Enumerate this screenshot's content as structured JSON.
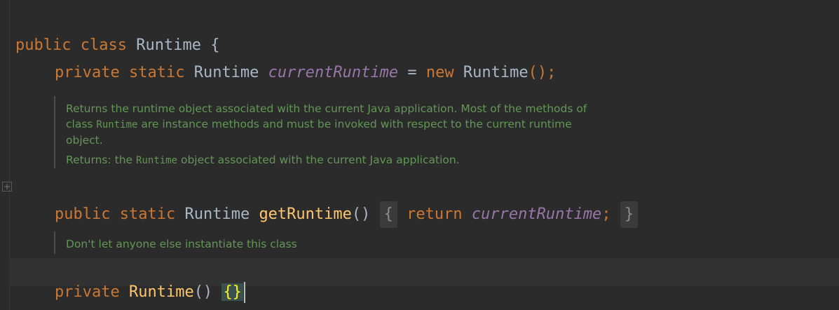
{
  "lines": {
    "class_decl": {
      "kw1": "public",
      "kw2": "class",
      "name": "Runtime",
      "brace": "{"
    },
    "field_decl": {
      "kw1": "private",
      "kw2": "static",
      "type": "Runtime",
      "field": "currentRuntime",
      "eq": "=",
      "kw3": "new",
      "ctor": "Runtime",
      "tail": "();"
    },
    "getruntime": {
      "kw1": "public",
      "kw2": "static",
      "type": "Runtime",
      "method": "getRuntime",
      "parens": "()",
      "open": "{",
      "ret": "return",
      "field": "currentRuntime",
      "semi": ";",
      "close": "}"
    },
    "ctor": {
      "kw1": "private",
      "name": "Runtime",
      "parens": "()",
      "braces": "{}"
    }
  },
  "docs": {
    "doc1": {
      "line1": "Returns the runtime object associated with the current Java application. Most of the methods of",
      "line2_pre": "class ",
      "line2_code": "Runtime",
      "line2_post": " are instance methods and must be invoked with respect to the current runtime",
      "line3": "object.",
      "ret_pre": "Returns: the ",
      "ret_code": "Runtime",
      "ret_post": " object associated with the current Java application."
    },
    "doc2": {
      "text": "Don't let anyone else instantiate this class"
    }
  },
  "fold_marker": "+"
}
